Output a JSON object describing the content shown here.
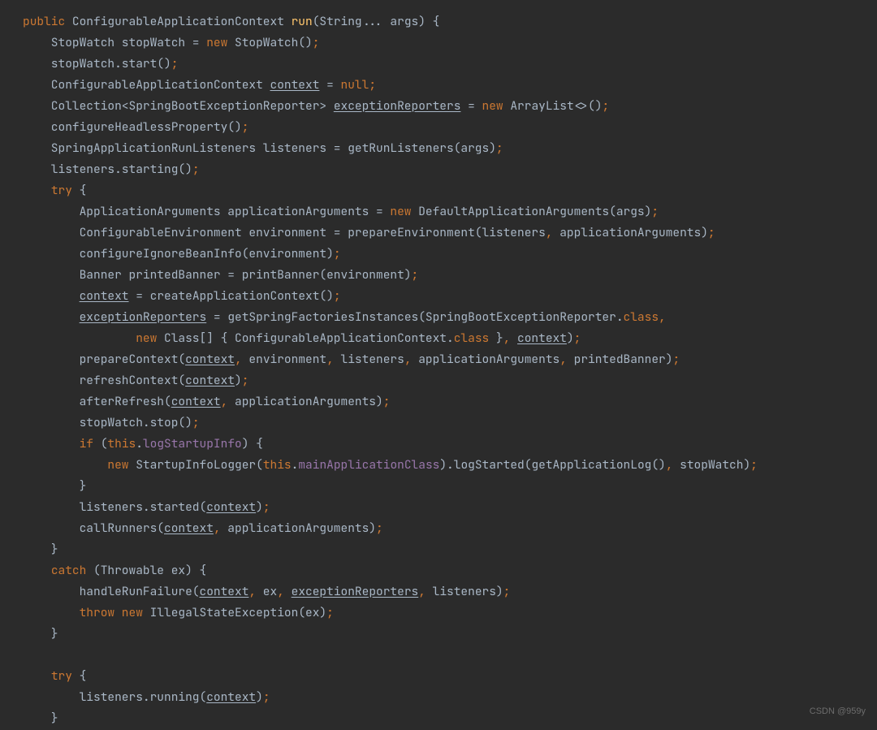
{
  "watermark": "CSDN @959y",
  "tokens": [
    [
      {
        "t": "kw",
        "s": "public"
      },
      {
        "t": "p",
        "s": " ConfigurableApplicationContext "
      },
      {
        "t": "mname",
        "s": "run"
      },
      {
        "t": "p",
        "s": "(String... args) {"
      }
    ],
    [
      {
        "t": "p",
        "s": "    StopWatch stopWatch = "
      },
      {
        "t": "kw",
        "s": "new"
      },
      {
        "t": "p",
        "s": " StopWatch()"
      },
      {
        "t": "kw",
        "s": ";"
      }
    ],
    [
      {
        "t": "p",
        "s": "    stopWatch.start()"
      },
      {
        "t": "kw",
        "s": ";"
      }
    ],
    [
      {
        "t": "p",
        "s": "    ConfigurableApplicationContext "
      },
      {
        "t": "u",
        "s": "context"
      },
      {
        "t": "p",
        "s": " = "
      },
      {
        "t": "kw",
        "s": "null;"
      }
    ],
    [
      {
        "t": "p",
        "s": "    Collection<SpringBootExceptionReporter> "
      },
      {
        "t": "u",
        "s": "exceptionReporters"
      },
      {
        "t": "p",
        "s": " = "
      },
      {
        "t": "kw",
        "s": "new"
      },
      {
        "t": "p",
        "s": " ArrayList<>()"
      },
      {
        "t": "kw",
        "s": ";"
      }
    ],
    [
      {
        "t": "p",
        "s": "    configureHeadlessProperty()"
      },
      {
        "t": "kw",
        "s": ";"
      }
    ],
    [
      {
        "t": "p",
        "s": "    SpringApplicationRunListeners listeners = getRunListeners(args)"
      },
      {
        "t": "kw",
        "s": ";"
      }
    ],
    [
      {
        "t": "p",
        "s": "    listeners.starting()"
      },
      {
        "t": "kw",
        "s": ";"
      }
    ],
    [
      {
        "t": "p",
        "s": "    "
      },
      {
        "t": "kw",
        "s": "try"
      },
      {
        "t": "p",
        "s": " {"
      }
    ],
    [
      {
        "t": "p",
        "s": "        ApplicationArguments applicationArguments = "
      },
      {
        "t": "kw",
        "s": "new"
      },
      {
        "t": "p",
        "s": " DefaultApplicationArguments(args)"
      },
      {
        "t": "kw",
        "s": ";"
      }
    ],
    [
      {
        "t": "p",
        "s": "        ConfigurableEnvironment environment = prepareEnvironment(listeners"
      },
      {
        "t": "kw",
        "s": ","
      },
      {
        "t": "p",
        "s": " applicationArguments)"
      },
      {
        "t": "kw",
        "s": ";"
      }
    ],
    [
      {
        "t": "p",
        "s": "        configureIgnoreBeanInfo(environment)"
      },
      {
        "t": "kw",
        "s": ";"
      }
    ],
    [
      {
        "t": "p",
        "s": "        Banner printedBanner = printBanner(environment)"
      },
      {
        "t": "kw",
        "s": ";"
      }
    ],
    [
      {
        "t": "p",
        "s": "        "
      },
      {
        "t": "u",
        "s": "context"
      },
      {
        "t": "p",
        "s": " = createApplicationContext()"
      },
      {
        "t": "kw",
        "s": ";"
      }
    ],
    [
      {
        "t": "p",
        "s": "        "
      },
      {
        "t": "u",
        "s": "exceptionReporters"
      },
      {
        "t": "p",
        "s": " = getSpringFactoriesInstances(SpringBootExceptionReporter."
      },
      {
        "t": "kw",
        "s": "class"
      },
      {
        "t": "kw",
        "s": ","
      }
    ],
    [
      {
        "t": "p",
        "s": "                "
      },
      {
        "t": "kw",
        "s": "new"
      },
      {
        "t": "p",
        "s": " Class[] { ConfigurableApplicationContext."
      },
      {
        "t": "kw",
        "s": "class"
      },
      {
        "t": "p",
        "s": " }"
      },
      {
        "t": "kw",
        "s": ","
      },
      {
        "t": "p",
        "s": " "
      },
      {
        "t": "u",
        "s": "context"
      },
      {
        "t": "p",
        "s": ")"
      },
      {
        "t": "kw",
        "s": ";"
      }
    ],
    [
      {
        "t": "p",
        "s": "        prepareContext("
      },
      {
        "t": "u",
        "s": "context"
      },
      {
        "t": "kw",
        "s": ","
      },
      {
        "t": "p",
        "s": " environment"
      },
      {
        "t": "kw",
        "s": ","
      },
      {
        "t": "p",
        "s": " listeners"
      },
      {
        "t": "kw",
        "s": ","
      },
      {
        "t": "p",
        "s": " applicationArguments"
      },
      {
        "t": "kw",
        "s": ","
      },
      {
        "t": "p",
        "s": " printedBanner)"
      },
      {
        "t": "kw",
        "s": ";"
      }
    ],
    [
      {
        "t": "p",
        "s": "        refreshContext("
      },
      {
        "t": "u",
        "s": "context"
      },
      {
        "t": "p",
        "s": ")"
      },
      {
        "t": "kw",
        "s": ";"
      }
    ],
    [
      {
        "t": "p",
        "s": "        afterRefresh("
      },
      {
        "t": "u",
        "s": "context"
      },
      {
        "t": "kw",
        "s": ","
      },
      {
        "t": "p",
        "s": " applicationArguments)"
      },
      {
        "t": "kw",
        "s": ";"
      }
    ],
    [
      {
        "t": "p",
        "s": "        stopWatch.stop()"
      },
      {
        "t": "kw",
        "s": ";"
      }
    ],
    [
      {
        "t": "p",
        "s": "        "
      },
      {
        "t": "kw",
        "s": "if"
      },
      {
        "t": "p",
        "s": " ("
      },
      {
        "t": "kw",
        "s": "this"
      },
      {
        "t": "p",
        "s": "."
      },
      {
        "t": "field",
        "s": "logStartupInfo"
      },
      {
        "t": "p",
        "s": ") {"
      }
    ],
    [
      {
        "t": "p",
        "s": "            "
      },
      {
        "t": "kw",
        "s": "new"
      },
      {
        "t": "p",
        "s": " StartupInfoLogger("
      },
      {
        "t": "kw",
        "s": "this"
      },
      {
        "t": "p",
        "s": "."
      },
      {
        "t": "field",
        "s": "mainApplicationClass"
      },
      {
        "t": "p",
        "s": ").logStarted(getApplicationLog()"
      },
      {
        "t": "kw",
        "s": ","
      },
      {
        "t": "p",
        "s": " stopWatch)"
      },
      {
        "t": "kw",
        "s": ";"
      }
    ],
    [
      {
        "t": "p",
        "s": "        }"
      }
    ],
    [
      {
        "t": "p",
        "s": "        listeners.started("
      },
      {
        "t": "u",
        "s": "context"
      },
      {
        "t": "p",
        "s": ")"
      },
      {
        "t": "kw",
        "s": ";"
      }
    ],
    [
      {
        "t": "p",
        "s": "        callRunners("
      },
      {
        "t": "u",
        "s": "context"
      },
      {
        "t": "kw",
        "s": ","
      },
      {
        "t": "p",
        "s": " applicationArguments)"
      },
      {
        "t": "kw",
        "s": ";"
      }
    ],
    [
      {
        "t": "p",
        "s": "    }"
      }
    ],
    [
      {
        "t": "p",
        "s": "    "
      },
      {
        "t": "kw",
        "s": "catch"
      },
      {
        "t": "p",
        "s": " (Throwable ex) {"
      }
    ],
    [
      {
        "t": "p",
        "s": "        handleRunFailure("
      },
      {
        "t": "u",
        "s": "context"
      },
      {
        "t": "kw",
        "s": ","
      },
      {
        "t": "p",
        "s": " ex"
      },
      {
        "t": "kw",
        "s": ","
      },
      {
        "t": "p",
        "s": " "
      },
      {
        "t": "u",
        "s": "exceptionReporters"
      },
      {
        "t": "kw",
        "s": ","
      },
      {
        "t": "p",
        "s": " listeners)"
      },
      {
        "t": "kw",
        "s": ";"
      }
    ],
    [
      {
        "t": "p",
        "s": "        "
      },
      {
        "t": "kw",
        "s": "throw new"
      },
      {
        "t": "p",
        "s": " IllegalStateException(ex)"
      },
      {
        "t": "kw",
        "s": ";"
      }
    ],
    [
      {
        "t": "p",
        "s": "    }"
      }
    ],
    [
      {
        "t": "p",
        "s": ""
      }
    ],
    [
      {
        "t": "p",
        "s": "    "
      },
      {
        "t": "kw",
        "s": "try"
      },
      {
        "t": "p",
        "s": " {"
      }
    ],
    [
      {
        "t": "p",
        "s": "        listeners.running("
      },
      {
        "t": "u",
        "s": "context"
      },
      {
        "t": "p",
        "s": ")"
      },
      {
        "t": "kw",
        "s": ";"
      }
    ],
    [
      {
        "t": "p",
        "s": "    }"
      }
    ]
  ]
}
